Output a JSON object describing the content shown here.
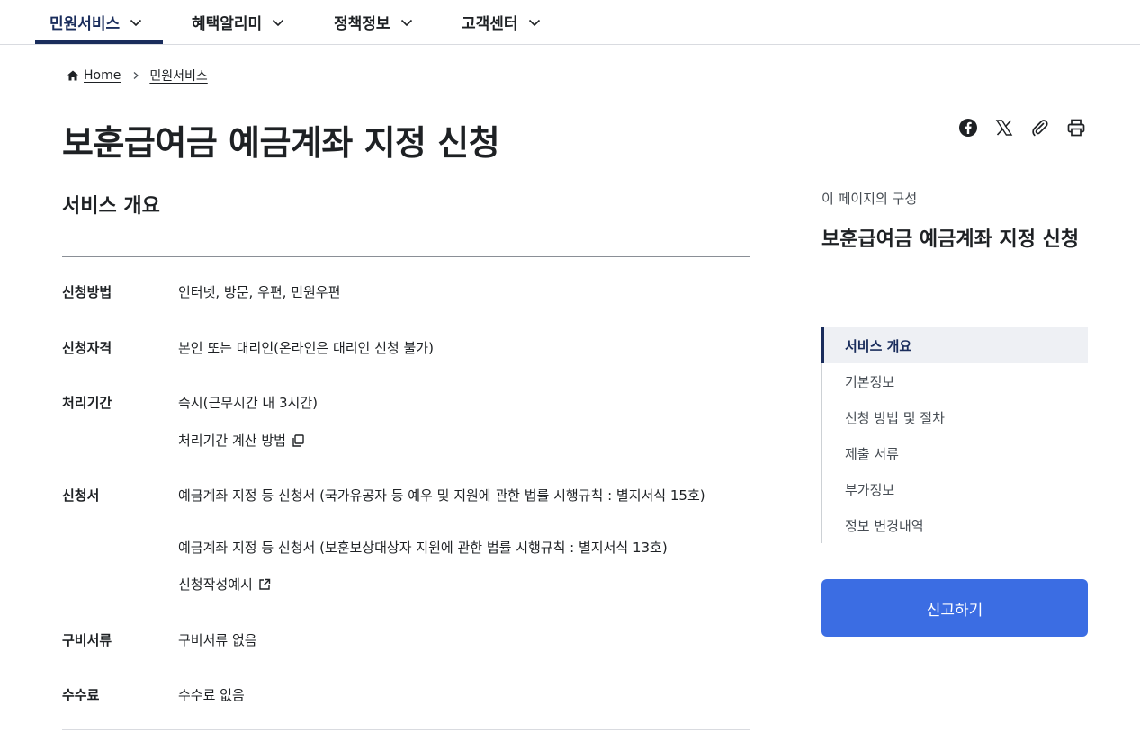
{
  "topnav": {
    "items": [
      {
        "label": "민원서비스",
        "active": true
      },
      {
        "label": "혜택알리미",
        "active": false
      },
      {
        "label": "정책정보",
        "active": false
      },
      {
        "label": "고객센터",
        "active": false
      }
    ]
  },
  "breadcrumb": {
    "home": "Home",
    "current": "민원서비스"
  },
  "page": {
    "title": "보훈급여금 예금계좌 지정 신청",
    "section_title": "서비스 개요"
  },
  "share": {
    "icons": [
      "facebook-icon",
      "x-icon",
      "link-icon",
      "print-icon"
    ]
  },
  "info": {
    "method_label": "신청방법",
    "method_value": "인터넷, 방문, 우편, 민원우편",
    "eligibility_label": "신청자격",
    "eligibility_value": "본인 또는 대리인(온라인은 대리인 신청 불가)",
    "period_label": "처리기간",
    "period_value": "즉시(근무시간 내 3시간)",
    "period_link": "처리기간 계산 방법",
    "form_label": "신청서",
    "form_value_1": "예금계좌 지정 등 신청서 (국가유공자 등 예우 및 지원에 관한 법률 시행규칙 : 별지서식 15호)",
    "form_value_2": "예금계좌 지정 등 신청서 (보훈보상대상자 지원에 관한 법률 시행규칙 : 별지서식 13호)",
    "form_link": "신청작성예시",
    "docs_label": "구비서류",
    "docs_value": "구비서류 없음",
    "fee_label": "수수료",
    "fee_value": "수수료 없음"
  },
  "toc": {
    "caption": "이 페이지의 구성",
    "title": "보훈급여금 예금계좌 지정 신청",
    "items": [
      {
        "label": "서비스 개요",
        "active": true
      },
      {
        "label": "기본정보",
        "active": false
      },
      {
        "label": "신청 방법 및 절차",
        "active": false
      },
      {
        "label": "제출 서류",
        "active": false
      },
      {
        "label": "부가정보",
        "active": false
      },
      {
        "label": "정보 변경내역",
        "active": false
      }
    ]
  },
  "report_button": "신고하기",
  "colors": {
    "primary_navy": "#1a2d5c",
    "button_blue": "#3b6de3",
    "text": "#1e2124"
  }
}
